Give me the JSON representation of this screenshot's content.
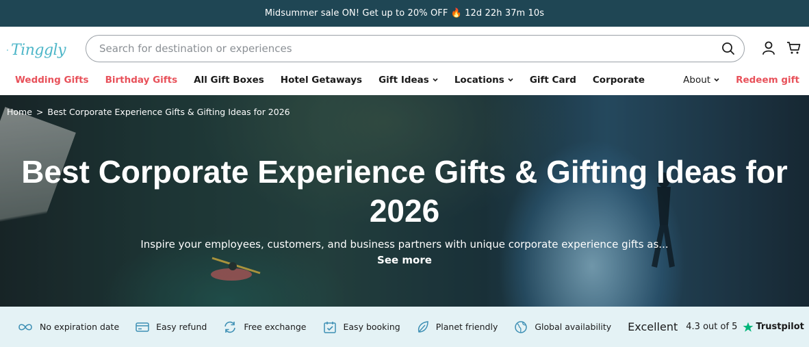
{
  "promo": {
    "text": "Midsummer sale ON! Get up to 20% OFF 🔥 12d 22h 37m 10s"
  },
  "header": {
    "logo_text": "Tinggly",
    "search_placeholder": "Search for destination or experiences",
    "icons": [
      "search-icon",
      "user-icon",
      "cart-icon"
    ]
  },
  "nav": {
    "left": [
      {
        "label": "Wedding Gifts",
        "highlight": true
      },
      {
        "label": "Birthday Gifts",
        "highlight": true
      },
      {
        "label": "All Gift Boxes"
      },
      {
        "label": "Hotel Getaways"
      },
      {
        "label": "Gift Ideas",
        "dropdown": true
      },
      {
        "label": "Locations",
        "dropdown": true
      },
      {
        "label": "Gift Card"
      },
      {
        "label": "Corporate"
      }
    ],
    "about": "About",
    "redeem": "Redeem gift"
  },
  "hero": {
    "breadcrumb": {
      "home": "Home",
      "separator": ">",
      "current": "Best Corporate Experience Gifts & Gifting Ideas for 2026"
    },
    "title": "Best Corporate Experience Gifts & Gifting Ideas for 2026",
    "subtitle": "Inspire your employees, customers, and business partners with unique corporate experience gifts as...",
    "see_more": "See more"
  },
  "features": [
    {
      "label": "No expiration date",
      "icon": "infinity-icon"
    },
    {
      "label": "Easy refund",
      "icon": "card-icon"
    },
    {
      "label": "Free exchange",
      "icon": "exchange-icon"
    },
    {
      "label": "Easy booking",
      "icon": "calendar-check-icon"
    },
    {
      "label": "Planet friendly",
      "icon": "leaf-icon"
    },
    {
      "label": "Global availability",
      "icon": "globe-icon"
    }
  ],
  "trustpilot": {
    "excellent": "Excellent",
    "rating": "4.3 out of 5",
    "brand": "Trustpilot"
  },
  "colors": {
    "promo_bg": "#1f4654",
    "accent_red": "#e8515a",
    "brand_teal": "#4db6c8",
    "features_bg": "#e4f2f5",
    "trustpilot_green": "#00b67a"
  }
}
